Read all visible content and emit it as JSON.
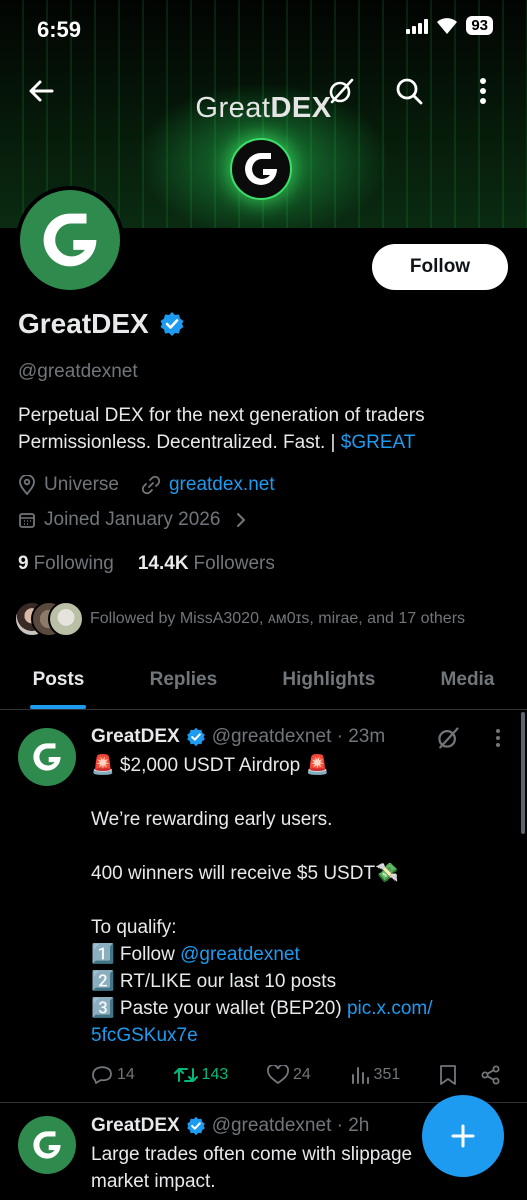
{
  "status_bar": {
    "time": "6:59",
    "battery": "93"
  },
  "banner": {
    "title_light": "Great",
    "title_bold": "DEX"
  },
  "profile": {
    "follow_label": "Follow",
    "display_name": "GreatDEX",
    "handle": "@greatdexnet",
    "bio_line1": "Perpetual DEX for the next generation of traders",
    "bio_line2_text": "Permissionless. Decentralized. Fast. | ",
    "bio_cashtag": "$GREAT",
    "location": "Universe",
    "website": "greatdex.net",
    "joined": "Joined January 2026",
    "following_count": "9",
    "following_label": "Following",
    "followers_count": "14.4K",
    "followers_label": "Followers",
    "followed_by": "Followed by MissA3020, ᴀᴍ0ɪѕ, mirae, and 17 others"
  },
  "tabs": [
    "Posts",
    "Replies",
    "Highlights",
    "Media"
  ],
  "posts": [
    {
      "name": "GreatDEX",
      "handle_time": "@greatdexnet · 23m",
      "lines": [
        "🚨 $2,000 USDT Airdrop 🚨",
        "",
        "We’re rewarding early users.",
        "",
        "400 winners will receive $5 USDT💸",
        "",
        "To qualify:"
      ],
      "step1_prefix": "1️⃣ Follow ",
      "step1_mention": "@greatdexnet",
      "step2": "2️⃣ RT/LIKE our last 10 posts",
      "step3_prefix": "3️⃣ Paste your wallet  (BEP20) ",
      "step3_link_a": "pic.x.com/",
      "step3_link_b": "5fcGSKux7e",
      "replies": "14",
      "reposts": "143",
      "likes": "24",
      "views": "351"
    },
    {
      "name": "GreatDEX",
      "handle_time": "@greatdexnet · 2h",
      "line1": "Large trades often come with slippage",
      "line2": "market impact."
    }
  ],
  "colors": {
    "accent": "#1d9bf0",
    "brand_green": "#2f8a4d",
    "repost_green": "#00ba7c",
    "muted": "#71767b"
  }
}
